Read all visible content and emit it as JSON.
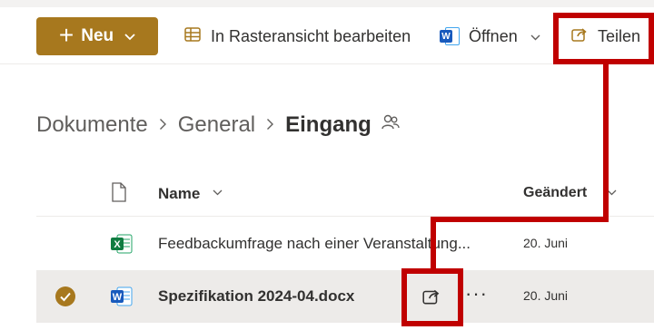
{
  "toolbar": {
    "new_label": "Neu",
    "grid_edit_label": "In Rasteransicht bearbeiten",
    "open_label": "Öffnen",
    "share_label": "Teilen"
  },
  "breadcrumb": {
    "items": [
      "Dokumente",
      "General"
    ],
    "current": "Eingang"
  },
  "list": {
    "columns": {
      "name": "Name",
      "modified": "Geändert"
    },
    "rows": [
      {
        "name": "Feedbackumfrage nach einer Veranstaltung...",
        "modified": "20. Juni",
        "type": "excel",
        "selected": false
      },
      {
        "name": "Spezifikation 2024-04.docx",
        "modified": "20. Juni",
        "type": "word",
        "selected": true
      }
    ]
  },
  "colors": {
    "accent": "#a7781e",
    "highlight": "#c00000",
    "selected_row": "#edebe9"
  }
}
